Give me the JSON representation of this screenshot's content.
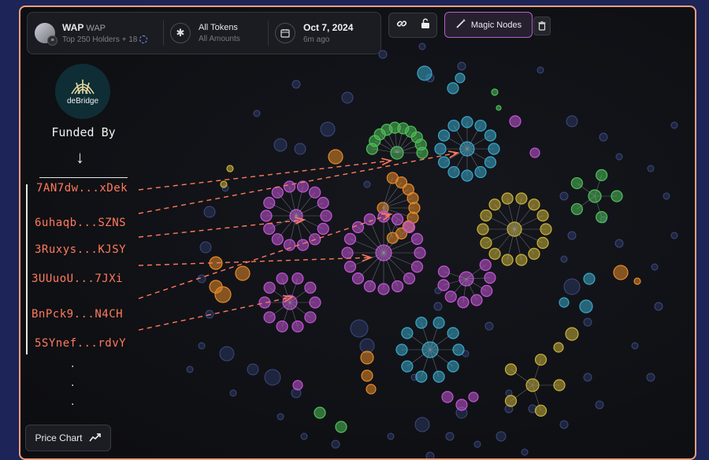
{
  "token": {
    "symbol": "WAP",
    "name": "WAP",
    "subtitle": "Top 250 Holders + 18"
  },
  "filter": {
    "line1": "All Tokens",
    "line2": "All Amounts"
  },
  "date": {
    "value": "Oct 7, 2024",
    "ago": "6m ago"
  },
  "toolbar": {
    "magic_label": "Magic Nodes"
  },
  "price_chart_label": "Price Chart",
  "annotation": {
    "logo_label": "deBridge",
    "funded_by": "Funded By",
    "addresses": [
      "7AN7dw...xDek",
      "6uhaqb...SZNS",
      "3Ruxys...KJSY",
      "3UUuoU...7JXi",
      "BnPck9...N4CH",
      "5SYnef...rdvY"
    ],
    "ellipsis": "."
  },
  "colors": {
    "border": "#f2a07a",
    "accent_magic": "#b45fd0",
    "annotation_red": "#ff7a5c",
    "background_outer": "#1d2458"
  },
  "clusters": [
    {
      "color": "#4fbf5a",
      "name": "green-cluster-top"
    },
    {
      "color": "#3aa7c9",
      "name": "blue-cluster-top"
    },
    {
      "color": "#c255d6",
      "name": "purple-cluster-left"
    },
    {
      "color": "#e58a2a",
      "name": "orange-cluster"
    },
    {
      "color": "#c255d6",
      "name": "purple-cluster-center"
    },
    {
      "color": "#c9b13a",
      "name": "yellow-cluster"
    },
    {
      "color": "#4fbf5a",
      "name": "green-cluster-right"
    },
    {
      "color": "#c255d6",
      "name": "purple-cluster-right"
    },
    {
      "color": "#c255d6",
      "name": "purple-cluster-bottom-left"
    },
    {
      "color": "#3aa7c9",
      "name": "blue-cluster-bottom"
    },
    {
      "color": "#c9b13a",
      "name": "yellow-cluster-bottom"
    }
  ]
}
